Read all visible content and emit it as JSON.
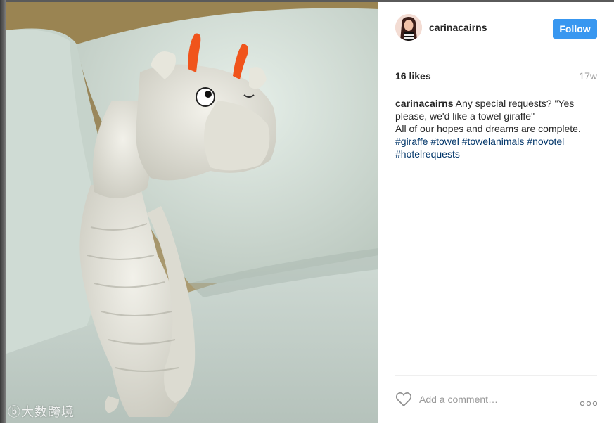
{
  "post": {
    "username": "carinacairns",
    "follow_label": "Follow",
    "likes": "16 likes",
    "age": "17w",
    "caption": {
      "author": "carinacairns",
      "line1": " Any special requests? \"Yes please, we'd like a towel giraffe\"",
      "line2": "All of our hopes and dreams are complete. ",
      "hashtags": [
        "#giraffe",
        "#towel",
        "#towelanimals",
        "#novotel",
        "#hotelrequests"
      ]
    },
    "comment_placeholder": "Add a comment…"
  },
  "watermark": "ⓑ大数跨境",
  "colors": {
    "follow": "#3897f0",
    "hashtag": "#003569",
    "muted": "#999999"
  },
  "icons": {
    "like": "heart-outline-icon",
    "more": "more-options-icon"
  }
}
